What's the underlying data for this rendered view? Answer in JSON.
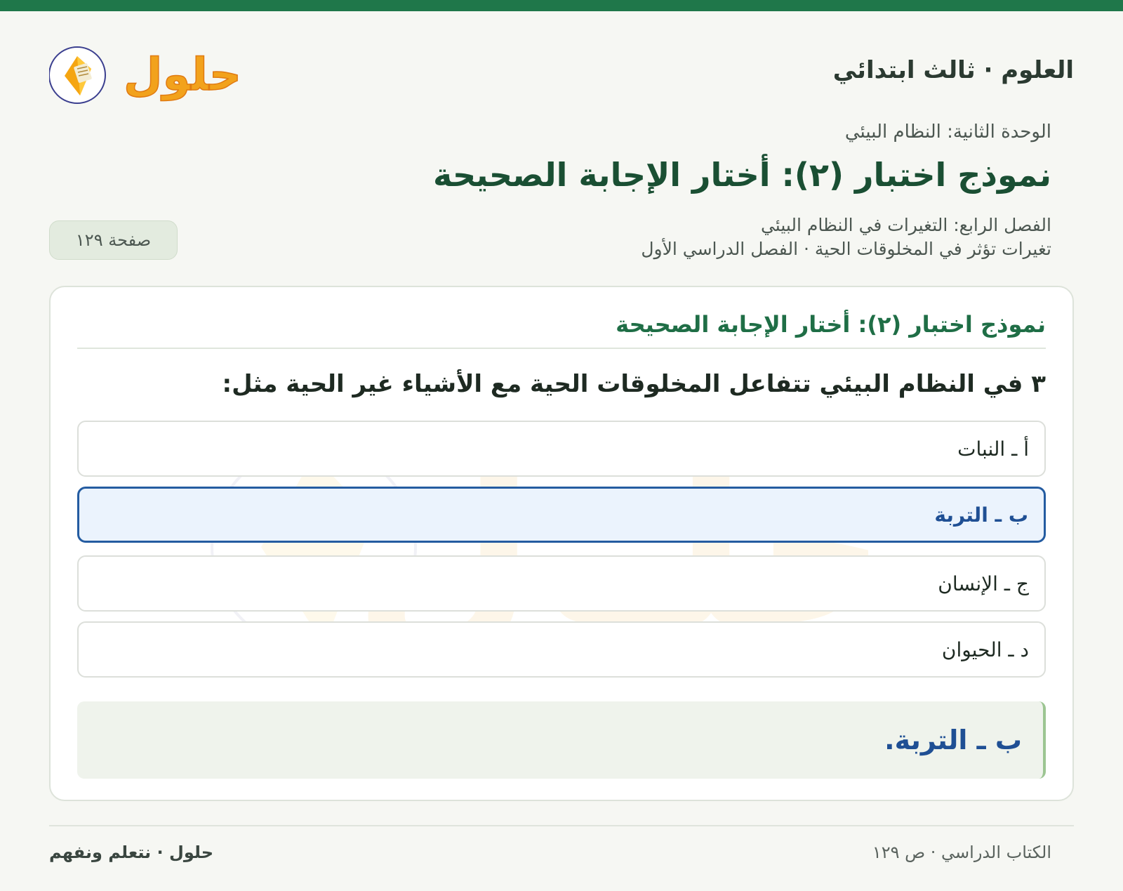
{
  "header": {
    "subject_title": "العلوم · ثالث ابتدائي",
    "logo_text": "حلول"
  },
  "lesson": {
    "unit": "الوحدة الثانية: النظام البيئي",
    "title": "نموذج اختبار (٢): أختار الإجابة الصحيحة",
    "chapter": "الفصل الرابع: التغيرات في النظام البيئي",
    "topic": "تغيرات تؤثر في المخلوقات الحية · الفصل الدراسي الأول",
    "page_badge": "صفحة ١٢٩"
  },
  "card": {
    "heading": "نموذج اختبار (٢): أختار الإجابة الصحيحة",
    "question": "٣ في النظام البيئي تتفاعل المخلوقات الحية مع الأشياء غير الحية مثل:",
    "options": [
      {
        "label": "أ ـ النبات",
        "selected": false
      },
      {
        "label": "ب ـ التربة",
        "selected": true
      },
      {
        "label": "ج ـ الإنسان",
        "selected": false
      },
      {
        "label": "د ـ الحيوان",
        "selected": false
      }
    ],
    "answer": "ب ـ التربة."
  },
  "footer": {
    "left": "حلول · نتعلم ونفهم",
    "right": "الكتاب الدراسي · ص ١٢٩"
  },
  "colors": {
    "brand_green": "#1f774a",
    "selected_blue": "#245ca1",
    "logo_orange": "#f2a21c"
  }
}
